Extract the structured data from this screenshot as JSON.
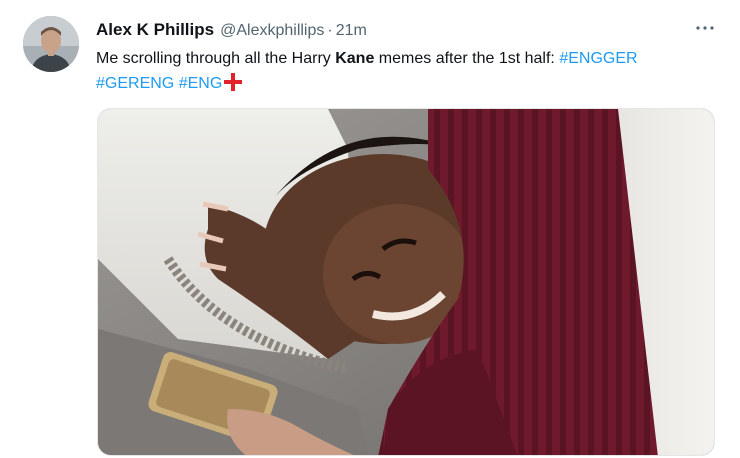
{
  "tweet": {
    "author_name": "Alex K Phillips",
    "handle": "@Alexkphillips",
    "separator": "·",
    "time": "21m",
    "more_icon": "more-horizontal-icon",
    "text": {
      "lead": "Me scrolling through all the Harry ",
      "keyword": "Kane",
      "trail": " memes after the 1st half: ",
      "hashtags": [
        "#ENGGER",
        "#GERENG",
        "#ENG"
      ]
    },
    "emoji": "flag-england-icon"
  },
  "colors": {
    "hashtag": "#1d9bf0",
    "secondary_text": "#536471",
    "flag_red": "#e2212b",
    "hoodie": "#6e1a2c"
  }
}
